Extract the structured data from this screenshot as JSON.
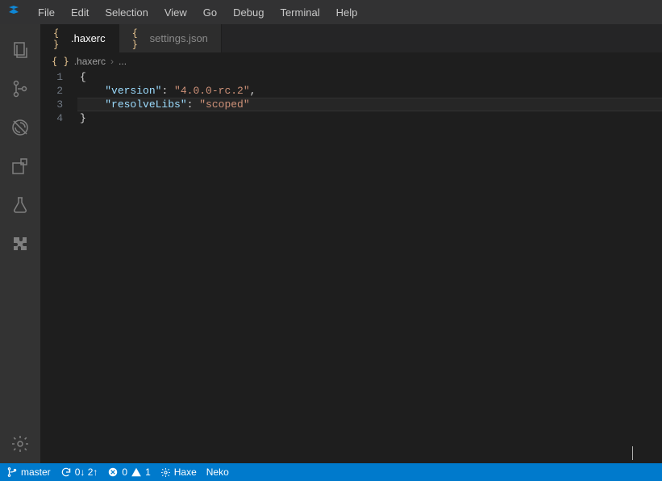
{
  "menus": [
    "File",
    "Edit",
    "Selection",
    "View",
    "Go",
    "Debug",
    "Terminal",
    "Help"
  ],
  "activity": [
    "files-icon",
    "scm-icon",
    "debug-icon",
    "extensions-icon",
    "beaker-icon",
    "puzzle-icon"
  ],
  "tabs": [
    {
      "icon": "{ }",
      "label": ".haxerc",
      "active": true
    },
    {
      "icon": "{ }",
      "label": "settings.json",
      "active": false
    }
  ],
  "breadcrumbs": {
    "icon": "{ }",
    "file": ".haxerc",
    "tail": "..."
  },
  "code": {
    "lineNumbers": [
      "1",
      "2",
      "3",
      "4"
    ],
    "line1_brace": "{",
    "line2_key": "\"version\"",
    "line2_colon": ": ",
    "line2_val": "\"4.0.0-rc.2\"",
    "line2_comma": ",",
    "line3_key": "\"resolveLibs\"",
    "line3_colon": ": ",
    "line3_val": "\"scoped\"",
    "line4_brace": "}"
  },
  "status": {
    "branch": "master",
    "sync": "0↓ 2↑",
    "errors": "0",
    "warnings": "1",
    "lang": "Haxe",
    "runtime": "Neko"
  }
}
